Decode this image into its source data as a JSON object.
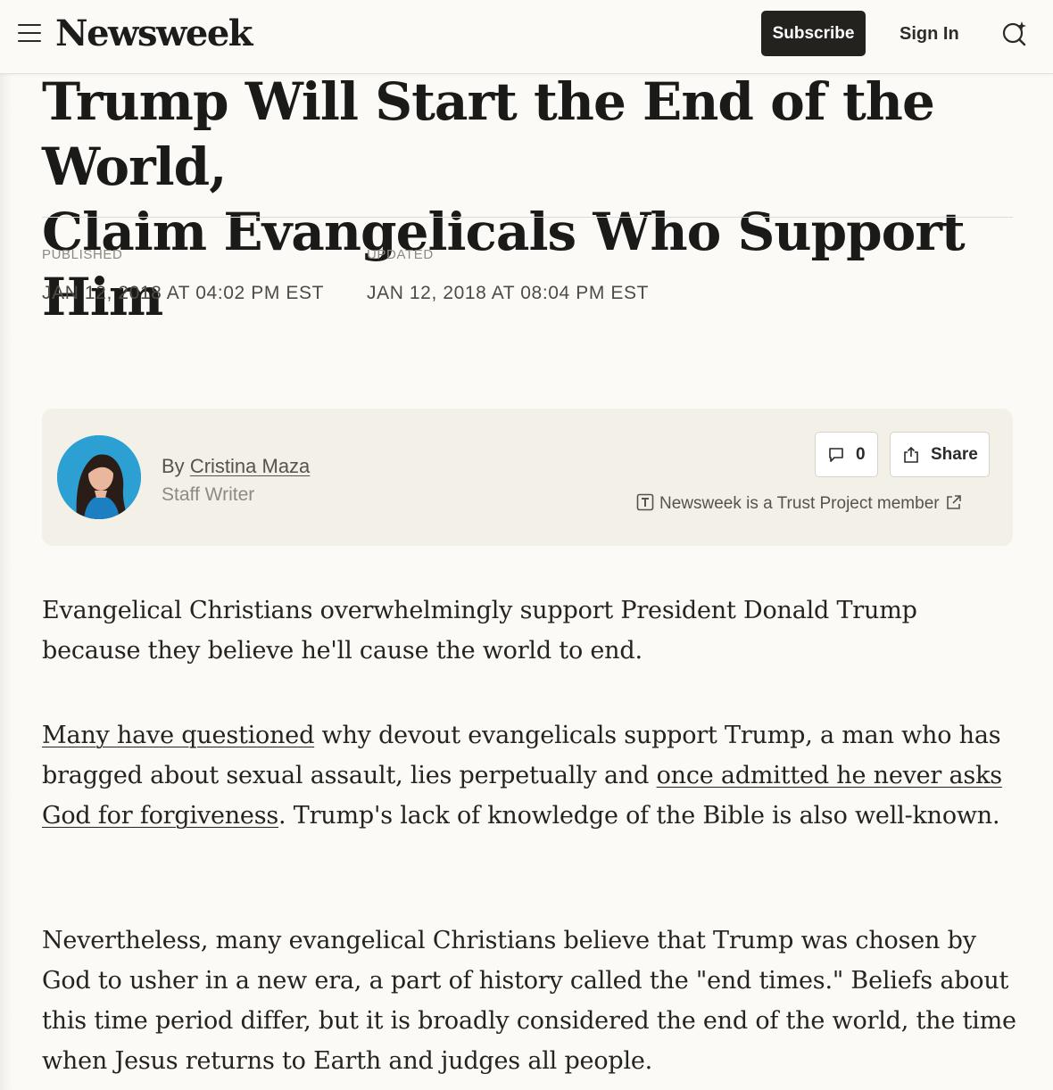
{
  "header": {
    "logo": "Newsweek",
    "subscribe_label": "Subscribe",
    "signin_label": "Sign In"
  },
  "article": {
    "headline_line1": "Trump Will Start the End of the World,",
    "headline_line2": "Claim Evangelicals Who Support Him",
    "published_label": "PUBLISHED",
    "published_value": "JAN 12, 2018 AT 04:02 PM EST",
    "updated_label": "UPDATED",
    "updated_value": "JAN 12, 2018 AT 08:04 PM EST"
  },
  "byline": {
    "by_prefix": "By",
    "author": "Cristina Maza",
    "role": "Staff Writer",
    "comment_count": "0",
    "share_label": "Share",
    "trust_text": "Newsweek is a Trust Project member"
  },
  "body": {
    "p1": "Evangelical Christians overwhelmingly support President Donald Trump because they believe he'll cause the world to end.",
    "p2_link1": "Many have questioned",
    "p2_text1": " why devout evangelicals support Trump, a man who has bragged about sexual assault, lies perpetually and ",
    "p2_link2": "once admitted he never asks God for forgiveness",
    "p2_text2": ". Trump's lack of knowledge of the Bible is also well-known.",
    "p3": "Nevertheless, many evangelical Christians believe that Trump was chosen by God to usher in a new era, a part of history called the \"end times.\" Beliefs about this time period differ, but it is broadly considered the end of the world, the time when Jesus returns to Earth and judges all people."
  },
  "colors": {
    "page_background": "#fbfaf6",
    "card_background": "#f3f0e7",
    "subscribe_background": "#23221f"
  }
}
